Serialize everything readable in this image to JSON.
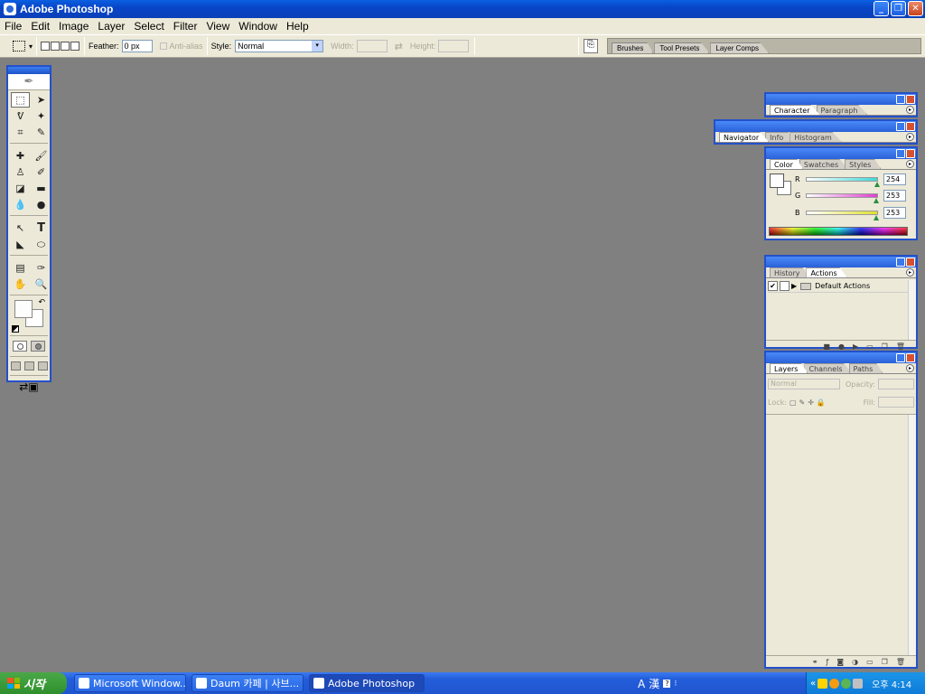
{
  "window": {
    "title": "Adobe Photoshop"
  },
  "menu": [
    "File",
    "Edit",
    "Image",
    "Layer",
    "Select",
    "Filter",
    "View",
    "Window",
    "Help"
  ],
  "options": {
    "feather_label": "Feather:",
    "feather_value": "0 px",
    "antialias_label": "Anti-alias",
    "style_label": "Style:",
    "style_value": "Normal",
    "width_label": "Width:",
    "height_label": "Height:"
  },
  "palette_well": {
    "tabs": [
      "Brushes",
      "Tool Presets",
      "Layer Comps"
    ]
  },
  "palettes": {
    "character": {
      "tabs": [
        "Character",
        "Paragraph"
      ]
    },
    "navigator": {
      "tabs": [
        "Navigator",
        "Info",
        "Histogram"
      ]
    },
    "color": {
      "tabs": [
        "Color",
        "Swatches",
        "Styles"
      ],
      "channels": [
        {
          "label": "R",
          "value": "254",
          "color": "#3fd8d8",
          "level": 0.996
        },
        {
          "label": "G",
          "value": "253",
          "color": "#e03fd0",
          "level": 0.992
        },
        {
          "label": "B",
          "value": "253",
          "color": "#e0e030",
          "level": 0.992
        }
      ]
    },
    "actions": {
      "tabs": [
        "History",
        "Actions"
      ],
      "items": [
        {
          "label": "Default Actions",
          "checked": true
        }
      ]
    },
    "layers": {
      "tabs": [
        "Layers",
        "Channels",
        "Paths"
      ],
      "blend_mode": "Normal",
      "opacity_label": "Opacity:",
      "lock_label": "Lock:",
      "fill_label": "Fill:"
    }
  },
  "taskbar": {
    "start_label": "시작",
    "tasks": [
      {
        "label": "Microsoft Window...",
        "active": false
      },
      {
        "label": "Daum 카페 | 사브...",
        "active": false
      },
      {
        "label": "Adobe Photoshop",
        "active": true
      }
    ],
    "ime": [
      "A",
      "漢"
    ],
    "clock": "오후 4:14"
  },
  "colors": {
    "accent": "#2450c9",
    "workspace": "#808080",
    "chrome": "#ece9d8"
  }
}
